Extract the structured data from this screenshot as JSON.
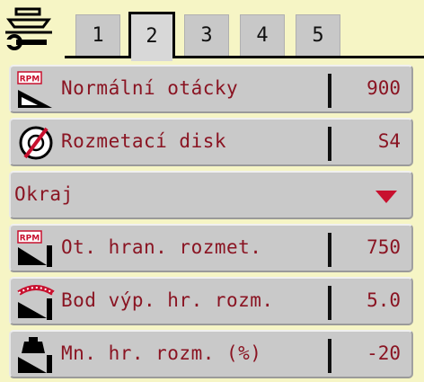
{
  "tabs": [
    "1",
    "2",
    "3",
    "4",
    "5"
  ],
  "active_tab": "2",
  "rows": [
    {
      "label": "Normální otácky",
      "value": "900",
      "icon": "rpm-ramp-icon"
    },
    {
      "label": "Rozmetací disk",
      "value": "S4",
      "icon": "spreading-disc-icon"
    },
    {
      "label": "Okraj",
      "type": "dropdown",
      "icon": "chevron-down-icon"
    },
    {
      "label": "Ot. hran. rozmet.",
      "value": "750",
      "icon": "border-rpm-icon"
    },
    {
      "label": "Bod výp. hr. rozm.",
      "value": "5.0",
      "icon": "border-cutoff-point-icon"
    },
    {
      "label": "Mn. hr. rozm. (%)",
      "value": "-20",
      "icon": "border-quantity-icon"
    }
  ],
  "icon_text": {
    "rpm": "RPM"
  },
  "colors": {
    "background": "#f6f5c5",
    "row": "#c9c9c9",
    "text": "#8a1422",
    "accent": "#c8102e"
  }
}
